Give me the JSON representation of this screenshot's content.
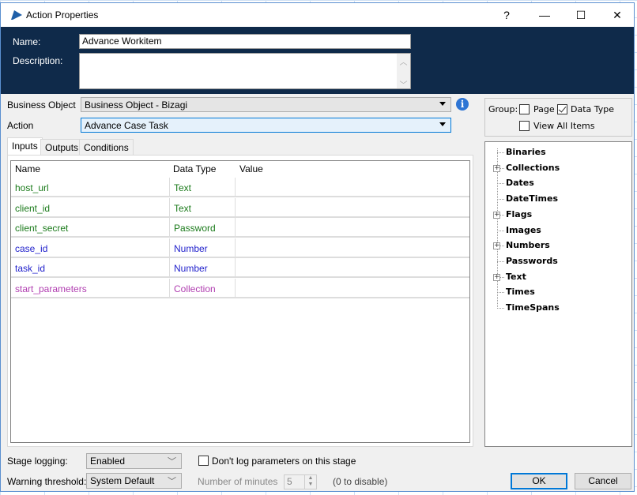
{
  "window": {
    "title": "Action Properties",
    "controls": {
      "help": "?",
      "minimize": "—",
      "maximize": "☐",
      "close": "✕"
    }
  },
  "header": {
    "name_label": "Name:",
    "name_value": "Advance Workitem",
    "description_label": "Description:",
    "description_value": ""
  },
  "business_object": {
    "label": "Business Object",
    "value": "Business Object - Bizagi"
  },
  "action": {
    "label": "Action",
    "value": "Advance Case Task"
  },
  "tabs": [
    {
      "label": "Inputs",
      "active": true
    },
    {
      "label": "Outputs",
      "active": false
    },
    {
      "label": "Conditions",
      "active": false
    }
  ],
  "grid": {
    "columns": [
      "Name",
      "Data Type",
      "Value"
    ],
    "rows": [
      {
        "name": "host_url",
        "type": "Text",
        "value": "",
        "color": "#1a7a1a"
      },
      {
        "name": "client_id",
        "type": "Text",
        "value": "",
        "color": "#1a7a1a"
      },
      {
        "name": "client_secret",
        "type": "Password",
        "value": "",
        "color": "#1a7a1a"
      },
      {
        "name": "case_id",
        "type": "Number",
        "value": "",
        "color": "#2222cc"
      },
      {
        "name": "task_id",
        "type": "Number",
        "value": "",
        "color": "#2222cc"
      },
      {
        "name": "start_parameters",
        "type": "Collection",
        "value": "",
        "color": "#b03db0"
      }
    ]
  },
  "group": {
    "label": "Group:",
    "page_label": "Page",
    "page_checked": false,
    "datatype_label": "Data Type",
    "datatype_checked": true,
    "viewall_label": "View All Items",
    "viewall_checked": false
  },
  "tree": [
    {
      "label": "Binaries",
      "expandable": false
    },
    {
      "label": "Collections",
      "expandable": true
    },
    {
      "label": "Dates",
      "expandable": false
    },
    {
      "label": "DateTimes",
      "expandable": false
    },
    {
      "label": "Flags",
      "expandable": true
    },
    {
      "label": "Images",
      "expandable": false
    },
    {
      "label": "Numbers",
      "expandable": true
    },
    {
      "label": "Passwords",
      "expandable": false
    },
    {
      "label": "Text",
      "expandable": true
    },
    {
      "label": "Times",
      "expandable": false
    },
    {
      "label": "TimeSpans",
      "expandable": false
    }
  ],
  "footer": {
    "stage_logging_label": "Stage logging:",
    "stage_logging_value": "Enabled",
    "dont_log_label": "Don't log parameters on this stage",
    "dont_log_checked": false,
    "warning_label": "Warning threshold:",
    "warning_value": "System Default",
    "minutes_label": "Number of minutes",
    "minutes_value": "5",
    "disable_hint": "(0 to disable)",
    "ok_label": "OK",
    "cancel_label": "Cancel"
  }
}
